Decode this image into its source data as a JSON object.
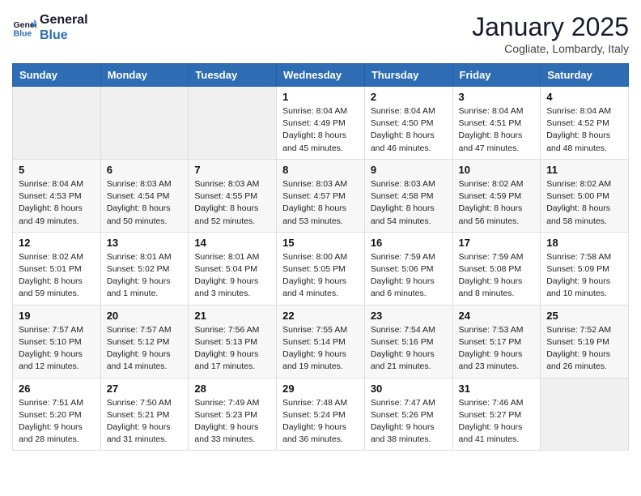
{
  "header": {
    "logo_line1": "General",
    "logo_line2": "Blue",
    "month": "January 2025",
    "location": "Cogliate, Lombardy, Italy"
  },
  "weekdays": [
    "Sunday",
    "Monday",
    "Tuesday",
    "Wednesday",
    "Thursday",
    "Friday",
    "Saturday"
  ],
  "weeks": [
    [
      {
        "day": "",
        "info": ""
      },
      {
        "day": "",
        "info": ""
      },
      {
        "day": "",
        "info": ""
      },
      {
        "day": "1",
        "info": "Sunrise: 8:04 AM\nSunset: 4:49 PM\nDaylight: 8 hours\nand 45 minutes."
      },
      {
        "day": "2",
        "info": "Sunrise: 8:04 AM\nSunset: 4:50 PM\nDaylight: 8 hours\nand 46 minutes."
      },
      {
        "day": "3",
        "info": "Sunrise: 8:04 AM\nSunset: 4:51 PM\nDaylight: 8 hours\nand 47 minutes."
      },
      {
        "day": "4",
        "info": "Sunrise: 8:04 AM\nSunset: 4:52 PM\nDaylight: 8 hours\nand 48 minutes."
      }
    ],
    [
      {
        "day": "5",
        "info": "Sunrise: 8:04 AM\nSunset: 4:53 PM\nDaylight: 8 hours\nand 49 minutes."
      },
      {
        "day": "6",
        "info": "Sunrise: 8:03 AM\nSunset: 4:54 PM\nDaylight: 8 hours\nand 50 minutes."
      },
      {
        "day": "7",
        "info": "Sunrise: 8:03 AM\nSunset: 4:55 PM\nDaylight: 8 hours\nand 52 minutes."
      },
      {
        "day": "8",
        "info": "Sunrise: 8:03 AM\nSunset: 4:57 PM\nDaylight: 8 hours\nand 53 minutes."
      },
      {
        "day": "9",
        "info": "Sunrise: 8:03 AM\nSunset: 4:58 PM\nDaylight: 8 hours\nand 54 minutes."
      },
      {
        "day": "10",
        "info": "Sunrise: 8:02 AM\nSunset: 4:59 PM\nDaylight: 8 hours\nand 56 minutes."
      },
      {
        "day": "11",
        "info": "Sunrise: 8:02 AM\nSunset: 5:00 PM\nDaylight: 8 hours\nand 58 minutes."
      }
    ],
    [
      {
        "day": "12",
        "info": "Sunrise: 8:02 AM\nSunset: 5:01 PM\nDaylight: 8 hours\nand 59 minutes."
      },
      {
        "day": "13",
        "info": "Sunrise: 8:01 AM\nSunset: 5:02 PM\nDaylight: 9 hours\nand 1 minute."
      },
      {
        "day": "14",
        "info": "Sunrise: 8:01 AM\nSunset: 5:04 PM\nDaylight: 9 hours\nand 3 minutes."
      },
      {
        "day": "15",
        "info": "Sunrise: 8:00 AM\nSunset: 5:05 PM\nDaylight: 9 hours\nand 4 minutes."
      },
      {
        "day": "16",
        "info": "Sunrise: 7:59 AM\nSunset: 5:06 PM\nDaylight: 9 hours\nand 6 minutes."
      },
      {
        "day": "17",
        "info": "Sunrise: 7:59 AM\nSunset: 5:08 PM\nDaylight: 9 hours\nand 8 minutes."
      },
      {
        "day": "18",
        "info": "Sunrise: 7:58 AM\nSunset: 5:09 PM\nDaylight: 9 hours\nand 10 minutes."
      }
    ],
    [
      {
        "day": "19",
        "info": "Sunrise: 7:57 AM\nSunset: 5:10 PM\nDaylight: 9 hours\nand 12 minutes."
      },
      {
        "day": "20",
        "info": "Sunrise: 7:57 AM\nSunset: 5:12 PM\nDaylight: 9 hours\nand 14 minutes."
      },
      {
        "day": "21",
        "info": "Sunrise: 7:56 AM\nSunset: 5:13 PM\nDaylight: 9 hours\nand 17 minutes."
      },
      {
        "day": "22",
        "info": "Sunrise: 7:55 AM\nSunset: 5:14 PM\nDaylight: 9 hours\nand 19 minutes."
      },
      {
        "day": "23",
        "info": "Sunrise: 7:54 AM\nSunset: 5:16 PM\nDaylight: 9 hours\nand 21 minutes."
      },
      {
        "day": "24",
        "info": "Sunrise: 7:53 AM\nSunset: 5:17 PM\nDaylight: 9 hours\nand 23 minutes."
      },
      {
        "day": "25",
        "info": "Sunrise: 7:52 AM\nSunset: 5:19 PM\nDaylight: 9 hours\nand 26 minutes."
      }
    ],
    [
      {
        "day": "26",
        "info": "Sunrise: 7:51 AM\nSunset: 5:20 PM\nDaylight: 9 hours\nand 28 minutes."
      },
      {
        "day": "27",
        "info": "Sunrise: 7:50 AM\nSunset: 5:21 PM\nDaylight: 9 hours\nand 31 minutes."
      },
      {
        "day": "28",
        "info": "Sunrise: 7:49 AM\nSunset: 5:23 PM\nDaylight: 9 hours\nand 33 minutes."
      },
      {
        "day": "29",
        "info": "Sunrise: 7:48 AM\nSunset: 5:24 PM\nDaylight: 9 hours\nand 36 minutes."
      },
      {
        "day": "30",
        "info": "Sunrise: 7:47 AM\nSunset: 5:26 PM\nDaylight: 9 hours\nand 38 minutes."
      },
      {
        "day": "31",
        "info": "Sunrise: 7:46 AM\nSunset: 5:27 PM\nDaylight: 9 hours\nand 41 minutes."
      },
      {
        "day": "",
        "info": ""
      }
    ]
  ]
}
